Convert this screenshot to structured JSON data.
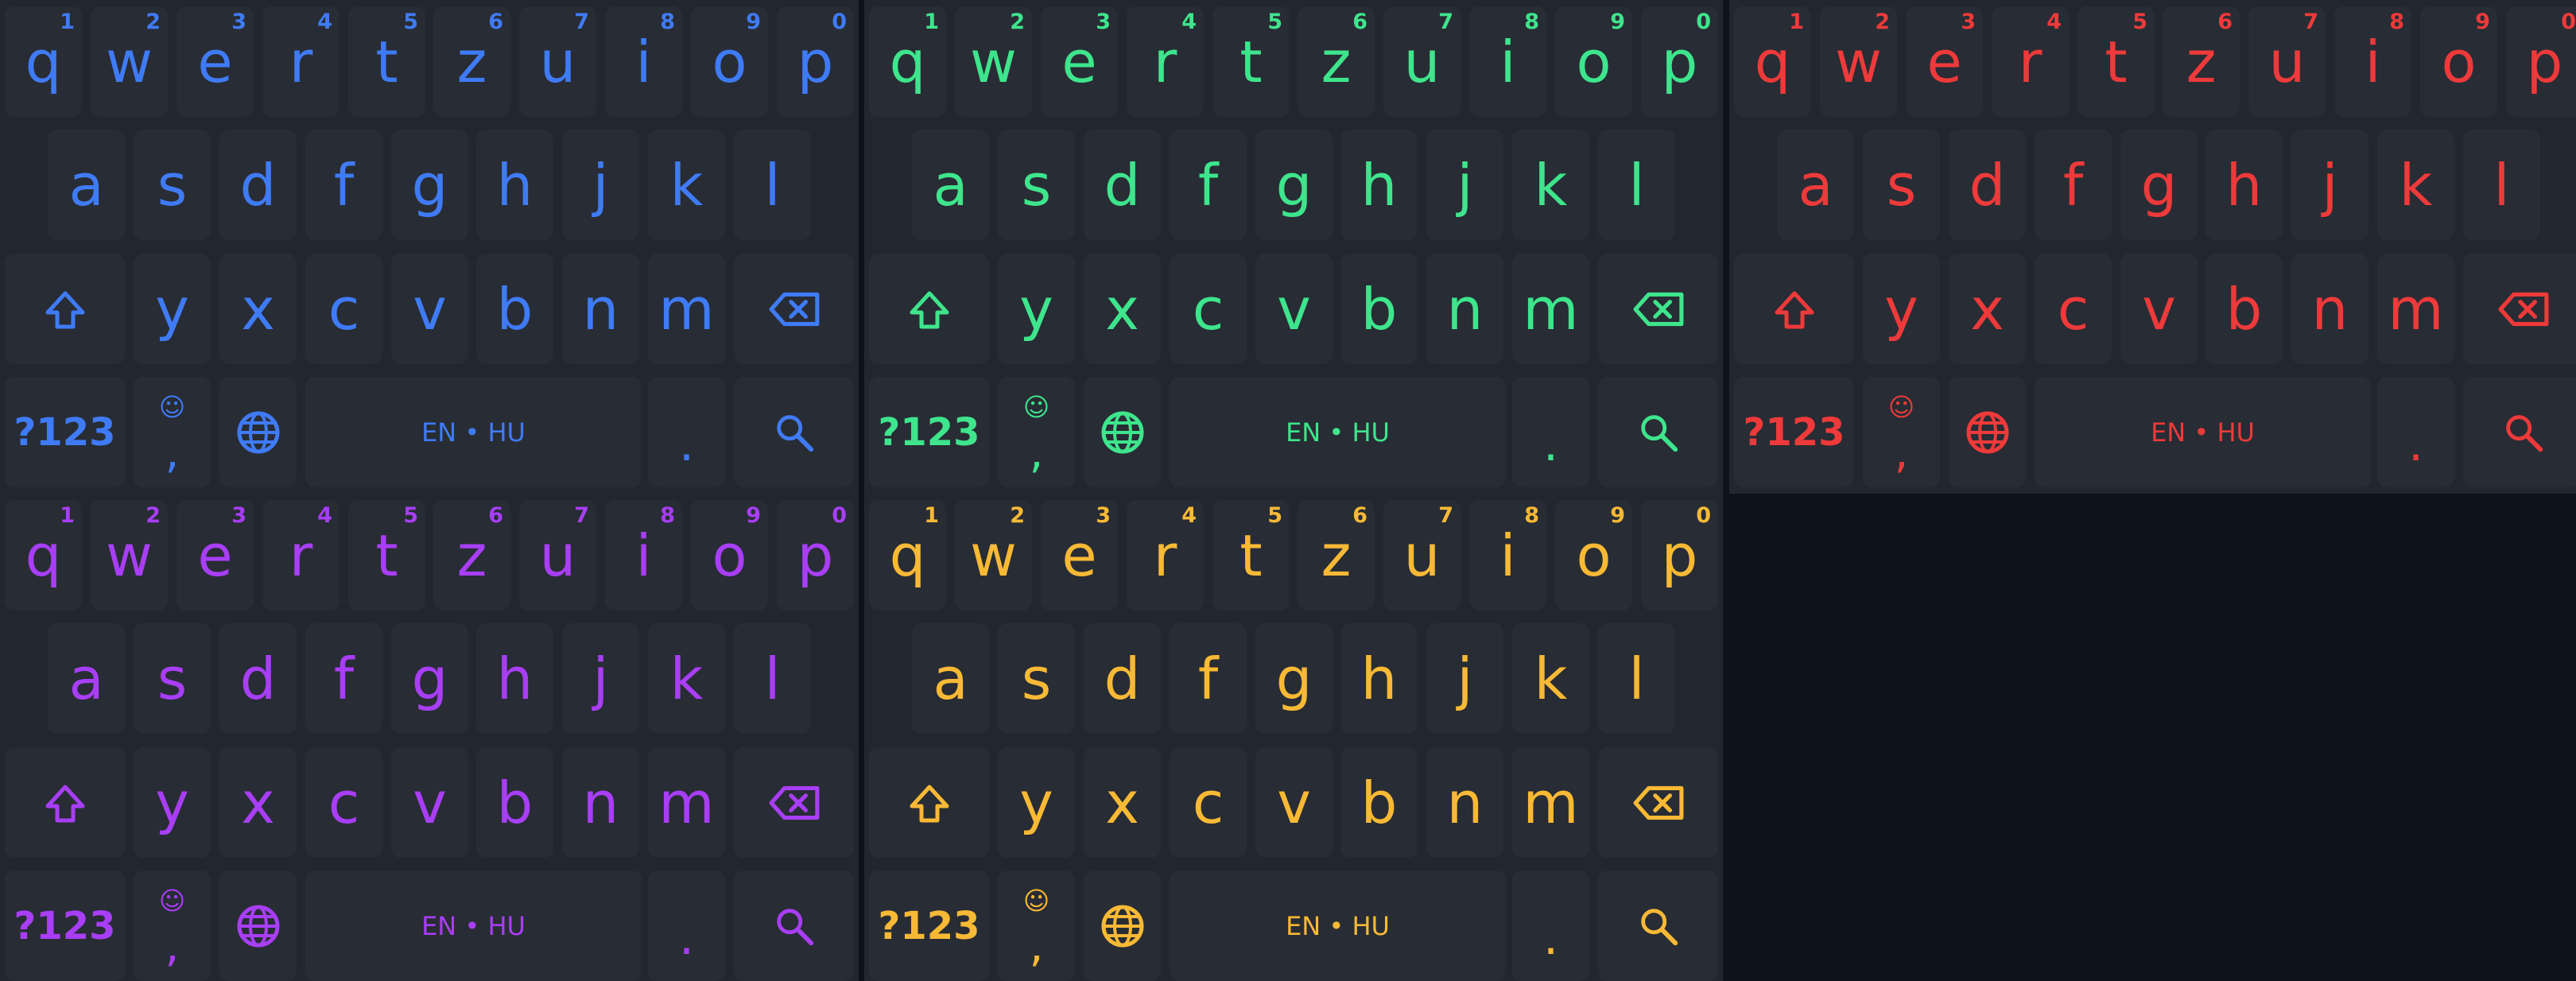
{
  "keyboards": [
    {
      "id": "blue",
      "color": "#3f7bf6"
    },
    {
      "id": "green",
      "color": "#3ee58c"
    },
    {
      "id": "red",
      "color": "#ee3a3a"
    },
    {
      "id": "purple",
      "color": "#a83ef6"
    },
    {
      "id": "yellow",
      "color": "#f8b935"
    }
  ],
  "layout": {
    "row1": [
      {
        "ch": "q",
        "num": "1"
      },
      {
        "ch": "w",
        "num": "2"
      },
      {
        "ch": "e",
        "num": "3"
      },
      {
        "ch": "r",
        "num": "4"
      },
      {
        "ch": "t",
        "num": "5"
      },
      {
        "ch": "z",
        "num": "6"
      },
      {
        "ch": "u",
        "num": "7"
      },
      {
        "ch": "i",
        "num": "8"
      },
      {
        "ch": "o",
        "num": "9"
      },
      {
        "ch": "p",
        "num": "0"
      }
    ],
    "row2": [
      "a",
      "s",
      "d",
      "f",
      "g",
      "h",
      "j",
      "k",
      "l"
    ],
    "row3": [
      "y",
      "x",
      "c",
      "v",
      "b",
      "n",
      "m"
    ],
    "bottom": {
      "symbols_label": "?123",
      "emoji_glyph": "☺",
      "comma_label": ",",
      "space_label": "EN • HU",
      "period_label": "."
    },
    "icons": {
      "shift": "shift-icon",
      "backspace": "backspace-icon",
      "globe": "globe-icon",
      "search": "search-icon"
    }
  }
}
